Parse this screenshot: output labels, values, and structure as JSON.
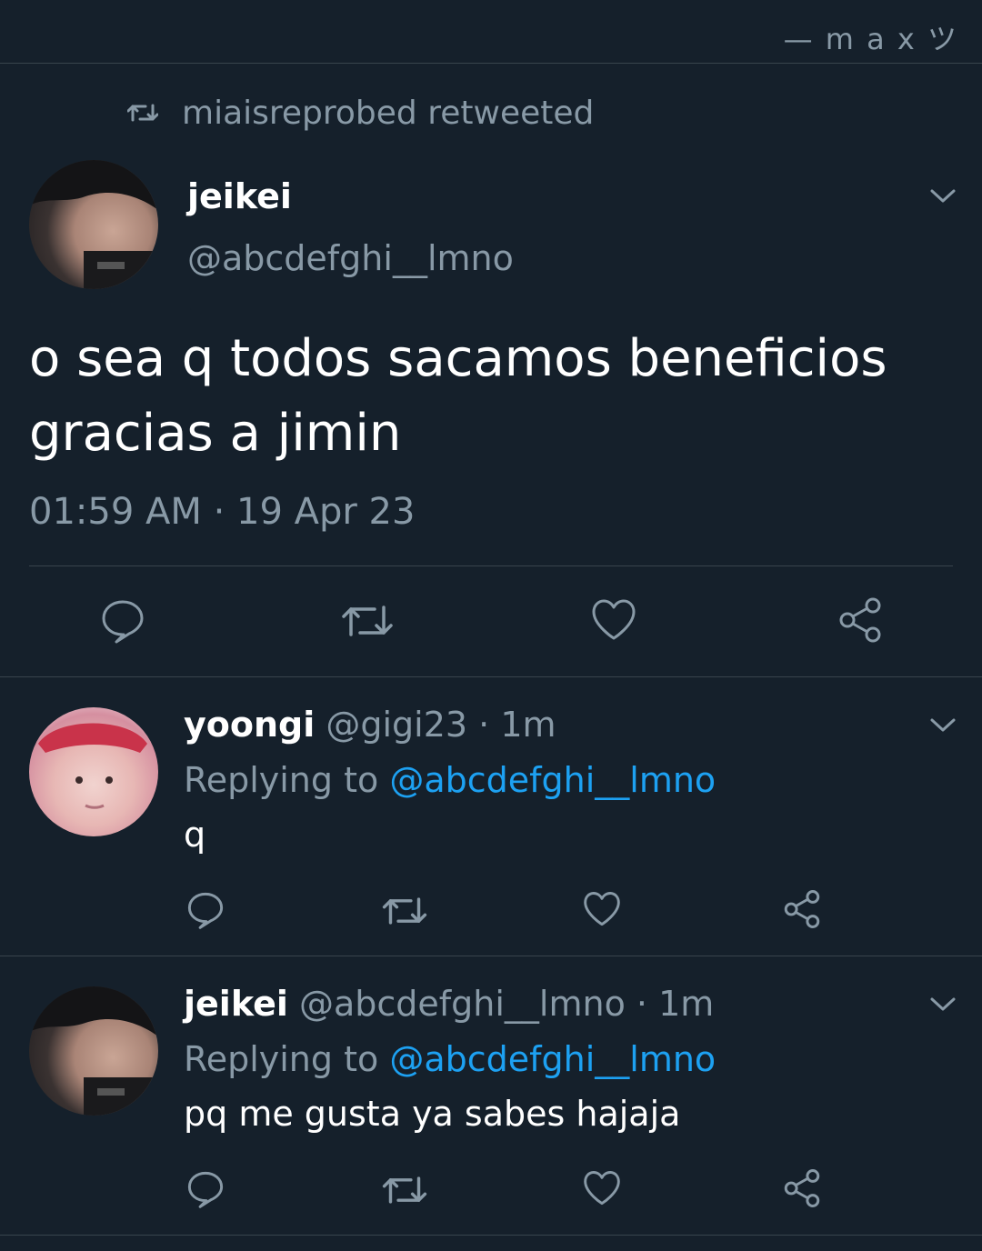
{
  "watermark": "— m a x ツ",
  "retweet_banner": {
    "icon": "retweet-icon",
    "text": "miaisreprobed retweeted"
  },
  "main_tweet": {
    "display_name": "jeikei",
    "handle": "@abcdefghi__lmno",
    "text_line1": "o sea q todos sacamos beneficios",
    "text_line2": "gracias a jimin",
    "timestamp": "01:59 AM · 19 Apr 23",
    "actions": [
      "reply-icon",
      "retweet-icon",
      "like-icon",
      "share-icon"
    ]
  },
  "replies": [
    {
      "display_name": "yoongi",
      "handle": "@gigi23",
      "time": "· 1m",
      "replying_prefix": "Replying to",
      "replying_to": "@abcdefghi__lmno",
      "text": "q"
    },
    {
      "display_name": "jeikei",
      "handle": "@abcdefghi__lmno",
      "time": "· 1m",
      "replying_prefix": "Replying to",
      "replying_to": "@abcdefghi__lmno",
      "text": "pq me gusta ya sabes hajaja"
    }
  ],
  "colors": {
    "background": "#15202b",
    "muted": "#8899a6",
    "link": "#1da1f2",
    "divider": "#38444d"
  }
}
